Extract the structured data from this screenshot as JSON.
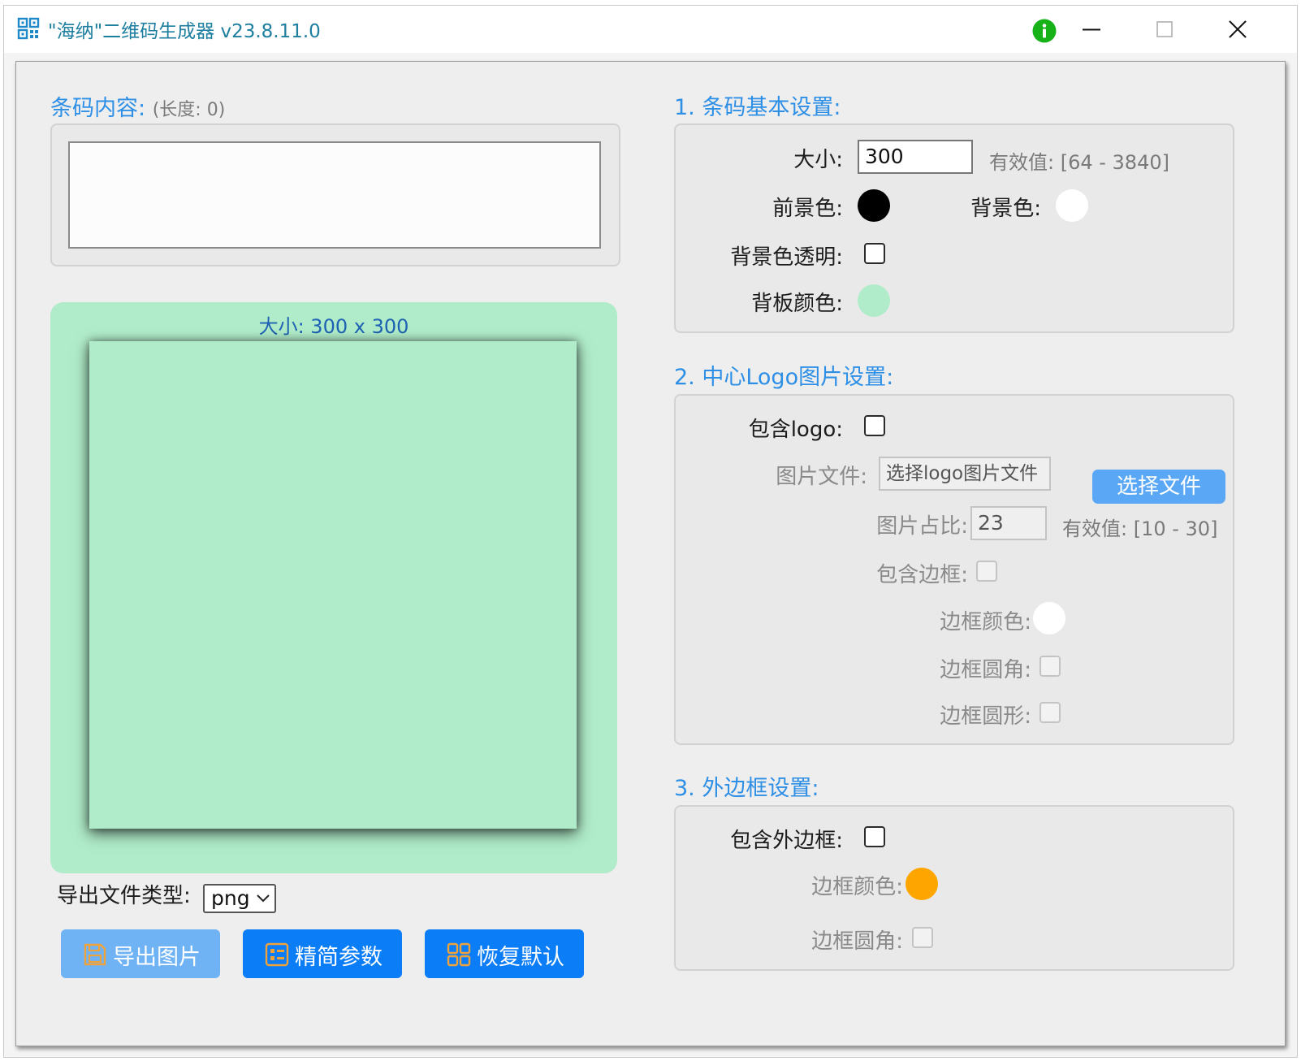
{
  "window": {
    "title": "\"海纳\"二维码生成器 v23.8.11.0"
  },
  "content_section": {
    "label": "条码内容:",
    "length_hint": "(长度: 0)",
    "value": ""
  },
  "preview": {
    "size_label": "大小: 300 x 300",
    "background_color": "#b0ecc9"
  },
  "export": {
    "type_label": "导出文件类型:",
    "type_value": "png",
    "buttons": {
      "export": "导出图片",
      "simplify": "精简参数",
      "restore": "恢复默认"
    }
  },
  "basic": {
    "title": "1. 条码基本设置:",
    "size_label": "大小:",
    "size_value": "300",
    "size_hint": "有效值: [64 - 3840]",
    "fg_label": "前景色:",
    "fg_color": "#000000",
    "bg_label": "背景色:",
    "bg_color": "#ffffff",
    "bg_transparent_label": "背景色透明:",
    "bg_transparent": false,
    "backplate_label": "背板颜色:",
    "backplate_color": "#b0ecc9"
  },
  "logo": {
    "title": "2. 中心Logo图片设置:",
    "include_label": "包含logo:",
    "include": false,
    "file_label": "图片文件:",
    "file_placeholder": "选择logo图片文件",
    "choose_button": "选择文件",
    "ratio_label": "图片占比:",
    "ratio_value": "23",
    "ratio_hint": "有效值: [10 - 30]",
    "border_label": "包含边框:",
    "border": false,
    "border_color_label": "边框颜色:",
    "border_color": "#ffffff",
    "border_round_label": "边框圆角:",
    "border_round": false,
    "border_circle_label": "边框圆形:",
    "border_circle": false
  },
  "outer": {
    "title": "3. 外边框设置:",
    "include_label": "包含外边框:",
    "include": false,
    "color_label": "边框颜色:",
    "color": "#ffa500",
    "round_label": "边框圆角:",
    "round": false
  }
}
